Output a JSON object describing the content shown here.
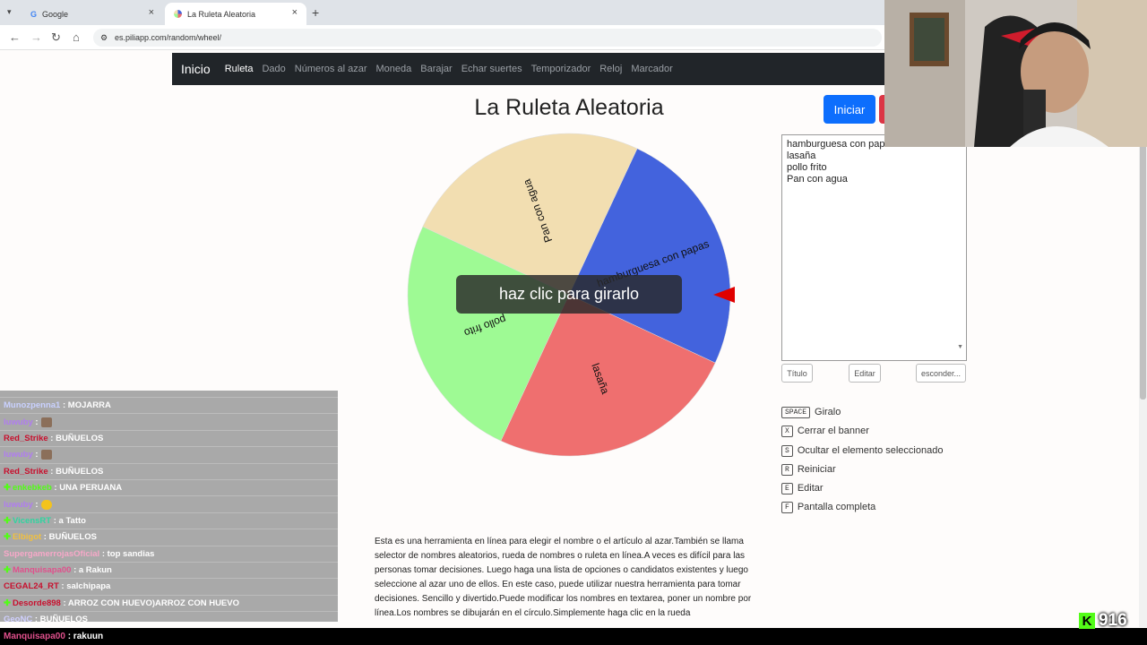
{
  "browser": {
    "tabs": [
      {
        "label": "Google",
        "active": false
      },
      {
        "label": "La Ruleta Aleatoria",
        "active": true
      }
    ],
    "url": "es.piliapp.com/random/wheel/"
  },
  "sitenav": {
    "brand": "Inicio",
    "links": [
      "Ruleta",
      "Dado",
      "Números al azar",
      "Moneda",
      "Barajar",
      "Echar suertes",
      "Temporizador",
      "Reloj",
      "Marcador"
    ]
  },
  "page": {
    "title": "La Ruleta Aleatoria",
    "start_button": "Iniciar",
    "spin_overlay": "haz clic para girarlo"
  },
  "wheel": {
    "segments": [
      {
        "label": "hamburguesa con papas",
        "color": "#4363dd",
        "share": 0.25
      },
      {
        "label": "lasaña",
        "color": "#ef6f6f",
        "share": 0.25
      },
      {
        "label": "pollo frito",
        "color": "#9efa94",
        "share": 0.25
      },
      {
        "label": "Pan con agua",
        "color": "#f2deb1",
        "share": 0.25
      }
    ],
    "pointer_color": "#e00000"
  },
  "names_textarea": [
    "hamburguesa con papas",
    "lasaña",
    "pollo frito",
    "Pan con agua"
  ],
  "panel_buttons": {
    "title": "Título",
    "edit": "Editar",
    "hide": "esconder..."
  },
  "shortcuts": [
    {
      "key": "SPACE",
      "label": "Giralo"
    },
    {
      "key": "X",
      "label": "Cerrar el banner"
    },
    {
      "key": "S",
      "label": "Ocultar el elemento seleccionado"
    },
    {
      "key": "R",
      "label": "Reiniciar"
    },
    {
      "key": "E",
      "label": "Editar"
    },
    {
      "key": "F",
      "label": "Pantalla completa"
    }
  ],
  "description": "Esta es una herramienta en línea para elegir el nombre o el artículo al azar.También se llama selector de nombres aleatorios, rueda de nombres o ruleta en línea.A veces es difícil para las personas tomar decisiones. Luego haga una lista de opciones o candidatos existentes y luego seleccione al azar uno de ellos. En este caso, puede utilizar nuestra herramienta para tomar decisiones. Sencillo y divertido.Puede modificar los nombres en textarea, poner un nombre por línea.Los nombres se dibujarán en el círculo.Simplemente haga clic en la rueda",
  "chat": [
    {
      "user": "Munozpenna1",
      "color": "#c9d1ff",
      "msg": ": MOJARRA",
      "plus": false,
      "emote": ""
    },
    {
      "user": "luwuby",
      "color": "#b07cf0",
      "msg": ":",
      "plus": false,
      "emote": "img"
    },
    {
      "user": "Red_Strike",
      "color": "#c8102e",
      "msg": ": BUÑUELOS",
      "plus": false,
      "emote": ""
    },
    {
      "user": "luwuby",
      "color": "#b07cf0",
      "msg": ":",
      "plus": false,
      "emote": "img"
    },
    {
      "user": "Red_Strike",
      "color": "#c8102e",
      "msg": ": BUÑUELOS",
      "plus": false,
      "emote": ""
    },
    {
      "user": "enkebkeb",
      "color": "#53fc18",
      "msg": ": UNA PERUANA",
      "plus": true,
      "emote": ""
    },
    {
      "user": "luwuby",
      "color": "#b07cf0",
      "msg": ":",
      "plus": false,
      "emote": "yellow"
    },
    {
      "user": "VicensRT",
      "color": "#30d5a0",
      "msg": ": a Tatto",
      "plus": true,
      "emote": ""
    },
    {
      "user": "Elbigot",
      "color": "#f0c040",
      "msg": ": BUÑUELOS",
      "plus": true,
      "emote": ""
    },
    {
      "user": "SupergamerrojasOficial",
      "color": "#f7a8c8",
      "msg": ": top sandias",
      "plus": false,
      "emote": ""
    },
    {
      "user": "Manquisapa00",
      "color": "#e0508c",
      "msg": ": a Rakun",
      "plus": true,
      "emote": ""
    },
    {
      "user": "CEGAL24_RT",
      "color": "#c8102e",
      "msg": ": salchipapa",
      "plus": false,
      "emote": ""
    },
    {
      "user": "Desorde898",
      "color": "#c8102e",
      "msg": ": ARROZ CON HUEVO)ARROZ CON HUEVO",
      "plus": true,
      "emote": ""
    },
    {
      "user": "GeoNC",
      "color": "#d0d0ff",
      "msg": ": BUÑUELOS",
      "plus": false,
      "emote": ""
    }
  ],
  "chat_bottom": {
    "user": "Manquisapa00",
    "msg": ": rakuun"
  },
  "viewers": {
    "count": "916",
    "icon": "kick-logo-icon"
  }
}
